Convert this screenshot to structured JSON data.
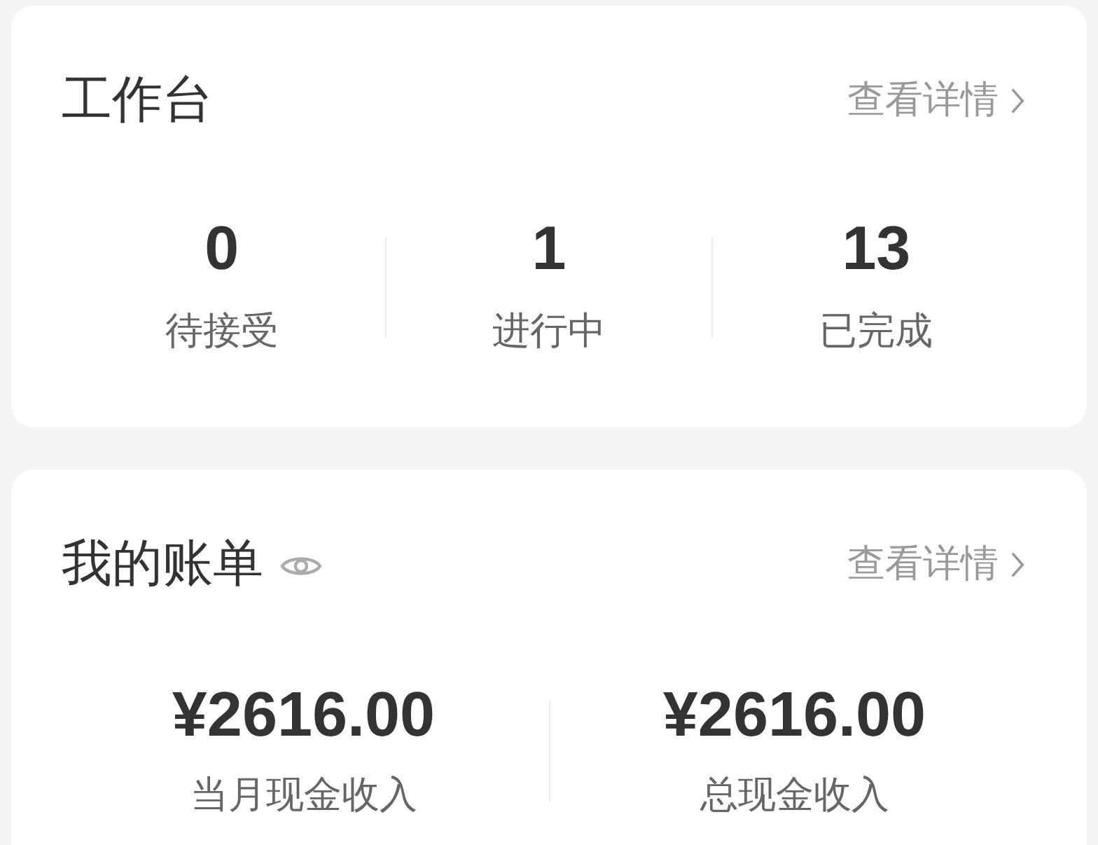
{
  "workbench": {
    "title": "工作台",
    "details_link": "查看详情",
    "stats": [
      {
        "value": "0",
        "label": "待接受"
      },
      {
        "value": "1",
        "label": "进行中"
      },
      {
        "value": "13",
        "label": "已完成"
      }
    ]
  },
  "bill": {
    "title": "我的账单",
    "details_link": "查看详情",
    "amounts": [
      {
        "value": "¥2616.00",
        "label": "当月现金收入"
      },
      {
        "value": "¥2616.00",
        "label": "总现金收入"
      }
    ]
  }
}
